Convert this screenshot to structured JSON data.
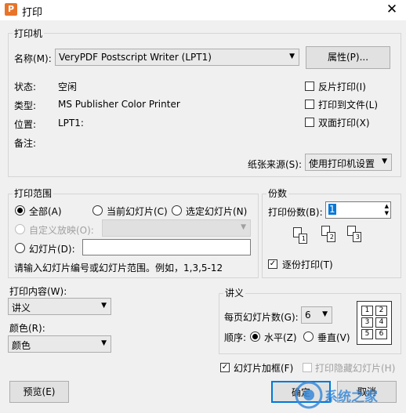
{
  "window": {
    "title": "打印",
    "app_icon_letter": "P",
    "close_glyph": "✕"
  },
  "printer": {
    "group_label": "打印机",
    "name_label": "名称(M):",
    "name_value": "VeryPDF Postscript Writer (LPT1)",
    "properties_button": "属性(P)...",
    "status_label": "状态:",
    "status_value": "空闲",
    "type_label": "类型:",
    "type_value": "MS Publisher Color Printer",
    "location_label": "位置:",
    "location_value": "LPT1:",
    "comment_label": "备注:",
    "reverse_print": "反片打印(I)",
    "print_to_file": "打印到文件(L)",
    "duplex": "双面打印(X)",
    "paper_source_label": "纸张来源(S):",
    "paper_source_value": "使用打印机设置"
  },
  "range": {
    "group_label": "打印范围",
    "all": "全部(A)",
    "current_slide": "当前幻灯片(C)",
    "selected_slides": "选定幻灯片(N)",
    "custom_show": "自定义放映(O):",
    "slides": "幻灯片(D):",
    "hint": "请输入幻灯片编号或幻灯片范围。例如，1,3,5-12"
  },
  "copies": {
    "group_label": "份数",
    "count_label": "打印份数(B):",
    "count_value": "1",
    "collate": "逐份打印(T)",
    "page_numbers": [
      "1",
      "2",
      "3"
    ]
  },
  "content": {
    "label": "打印内容(W):",
    "value": "讲义",
    "color_label": "颜色(R):",
    "color_value": "颜色"
  },
  "handout": {
    "group_label": "讲义",
    "per_page_label": "每页幻灯片数(G):",
    "per_page_value": "6",
    "order_label": "顺序:",
    "horizontal": "水平(Z)",
    "vertical": "垂直(V)",
    "preview_cells": [
      "1",
      "2",
      "3",
      "4",
      "5",
      "6"
    ]
  },
  "options": {
    "frame_slides": "幻灯片加框(F)",
    "print_hidden": "打印隐藏幻灯片(H)"
  },
  "buttons": {
    "preview": "预览(E)",
    "ok": "确定",
    "cancel": "取消"
  },
  "watermark": {
    "text": "系统之家"
  }
}
